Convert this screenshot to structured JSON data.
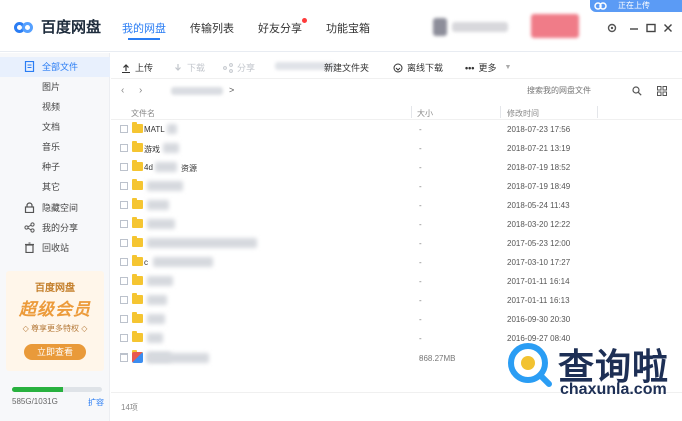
{
  "app": {
    "name": "百度网盘"
  },
  "tabs": [
    {
      "label": "我的网盘",
      "active": true
    },
    {
      "label": "传输列表"
    },
    {
      "label": "好友分享",
      "badge": true
    },
    {
      "label": "功能宝箱"
    }
  ],
  "top_right": {
    "badge_text": "正在上传"
  },
  "sidebar": {
    "items": [
      {
        "label": "全部文件",
        "icon": "document-icon",
        "active": true
      },
      {
        "label": "图片"
      },
      {
        "label": "视频"
      },
      {
        "label": "文档"
      },
      {
        "label": "音乐"
      },
      {
        "label": "种子"
      },
      {
        "label": "其它"
      },
      {
        "label": "隐藏空间",
        "icon": "lock-icon"
      },
      {
        "label": "我的分享",
        "icon": "share-icon"
      },
      {
        "label": "回收站",
        "icon": "trash-icon"
      }
    ],
    "promo": {
      "title": "百度网盘",
      "headline": "超级会员",
      "subtitle": "◇ 尊享更多特权 ◇",
      "button": "立即查看"
    },
    "storage": {
      "used_text": "585G/1031G",
      "used_fraction": 0.567,
      "expand": "扩容",
      "fill_color": "#28b13f"
    }
  },
  "toolbar": {
    "upload": "上传",
    "download": "下载",
    "share": "分享",
    "new_folder": "新建文件夹",
    "offline": "离线下载",
    "more": "更多"
  },
  "address": {
    "path_suffix": ">",
    "search_placeholder": "搜索我的网盘文件"
  },
  "list": {
    "header": {
      "name": "文件名",
      "size": "大小",
      "date": "修改时间"
    },
    "rows": [
      {
        "name": "MATL",
        "size": "-",
        "date": "2018-07-23 17:56"
      },
      {
        "name": "游戏",
        "size": "-",
        "date": "2018-07-21 13:19"
      },
      {
        "name": "4d",
        "name_tail": "资源",
        "size": "-",
        "date": "2018-07-19 18:52"
      },
      {
        "name": "",
        "size": "-",
        "date": "2018-07-19 18:49"
      },
      {
        "name": "",
        "size": "-",
        "date": "2018-05-24 11:43"
      },
      {
        "name": "",
        "size": "-",
        "date": "2018-03-20 12:22"
      },
      {
        "name": "",
        "size": "-",
        "date": "2017-05-23 12:00"
      },
      {
        "name": "c",
        "size": "-",
        "date": "2017-03-10 17:27"
      },
      {
        "name": "",
        "size": "-",
        "date": "2017-01-11 16:14"
      },
      {
        "name": "",
        "size": "-",
        "date": "2017-01-11 16:13"
      },
      {
        "name": "",
        "size": "-",
        "date": "2016-09-30 20:30"
      },
      {
        "name": "",
        "size": "-",
        "date": "2016-09-27 08:40"
      },
      {
        "name": "",
        "size": "-",
        "date": ""
      },
      {
        "name": "",
        "size": "868.27MB",
        "date": "",
        "file": true
      }
    ],
    "count": "14项"
  },
  "watermark": {
    "text": "查询啦",
    "url": "chaxunla.com"
  }
}
